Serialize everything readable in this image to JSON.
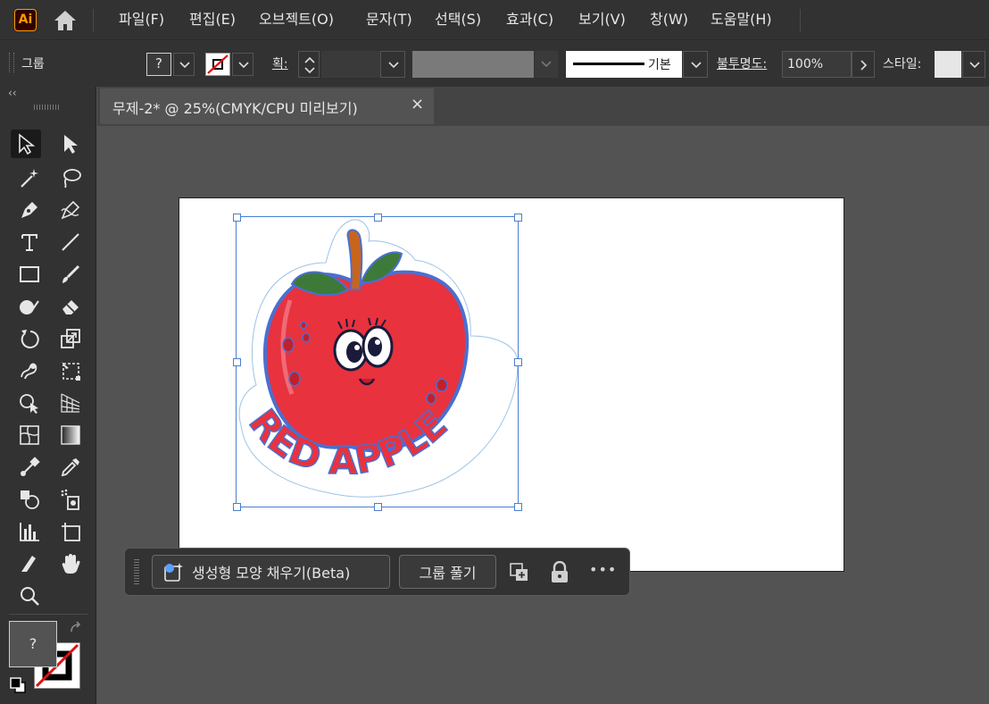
{
  "app": {
    "logo_text": "Ai",
    "home_icon": "home-icon"
  },
  "menu": {
    "items": [
      "파일(F)",
      "편집(E)",
      "오브젝트(O)",
      "문자(T)",
      "선택(S)",
      "효과(C)",
      "보기(V)",
      "창(W)",
      "도움말(H)"
    ]
  },
  "control_bar": {
    "selection_label": "그룹",
    "fill_value": "?",
    "stroke_label": "획:",
    "stroke_profile": "기본",
    "opacity_label": "불투명도:",
    "opacity_value": "100%",
    "style_label": "스타일:"
  },
  "document": {
    "tab_title": "무제-2* @ 25%(CMYK/CPU 미리보기)",
    "close_glyph": "×"
  },
  "artwork": {
    "text": "RED APPLE",
    "colors": {
      "apple_red": "#e8323e",
      "leaf_green": "#3d7a3a",
      "stem_orange": "#c8651c",
      "selection_blue": "#4a7fd1"
    }
  },
  "context_bar": {
    "generative_fill_label": "생성형 모양 채우기(Beta)",
    "ungroup_label": "그룹 풀기",
    "more_glyph": "•••"
  },
  "toolbar": {
    "collapse_glyph": "‹‹",
    "fill_swatch_value": "?"
  }
}
